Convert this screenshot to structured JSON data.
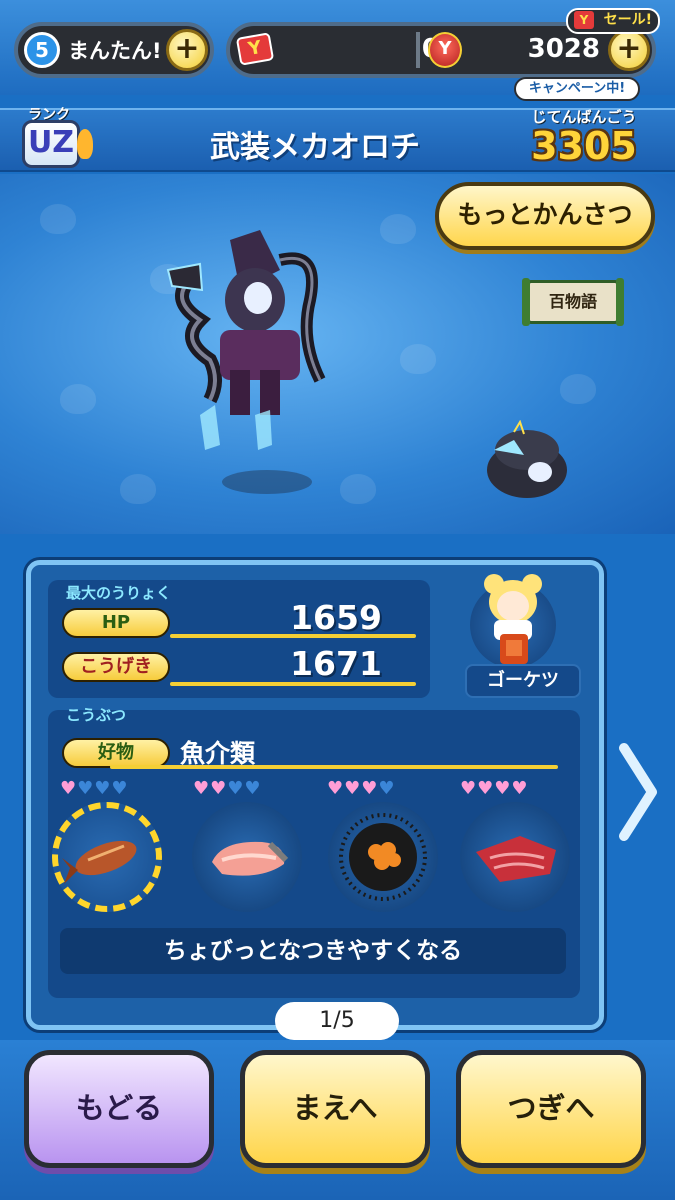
{
  "status_bar": {
    "level": "5",
    "stamina_label": "まんたん!",
    "tickets": "0",
    "coins": "3028",
    "sale_label": "セール!",
    "campaign_label": "キャンペーン中!"
  },
  "header": {
    "rank_label": "ランク",
    "rank": "UZ",
    "yokai_name": "武装メカオロチ",
    "dex_label": "じてんばんごう",
    "dex_number": "3305"
  },
  "stage": {
    "observe_label": "もっとかんさつ",
    "hyaku_label": "百物語"
  },
  "stats": {
    "section_label": "最大のうりょく",
    "hp_label": "HP",
    "hp_value": "1659",
    "attack_label": "こうげき",
    "attack_value": "1671",
    "tribe_label": "ゴーケツ"
  },
  "food": {
    "section_label": "こうぶつ",
    "favorite_label": "好物",
    "favorite_value": "魚介類",
    "items": [
      {
        "name": "fried-fish",
        "pink_hearts": 1,
        "blue_hearts": 3
      },
      {
        "name": "salmon",
        "pink_hearts": 2,
        "blue_hearts": 2
      },
      {
        "name": "sea-urchin",
        "pink_hearts": 3,
        "blue_hearts": 1
      },
      {
        "name": "tuna",
        "pink_hearts": 4,
        "blue_hearts": 0
      }
    ],
    "description": "ちょびっとなつきやすくなる"
  },
  "pagination": {
    "page_indicator": "1/5"
  },
  "nav": {
    "back_label": "もどる",
    "prev_label": "まえへ",
    "next_label": "つぎへ"
  },
  "colors": {
    "accent_yellow": "#f4cf35",
    "panel_blue": "#1d61a8",
    "heart_pink": "#ff9ed6",
    "heart_blue": "#3b86d8"
  }
}
